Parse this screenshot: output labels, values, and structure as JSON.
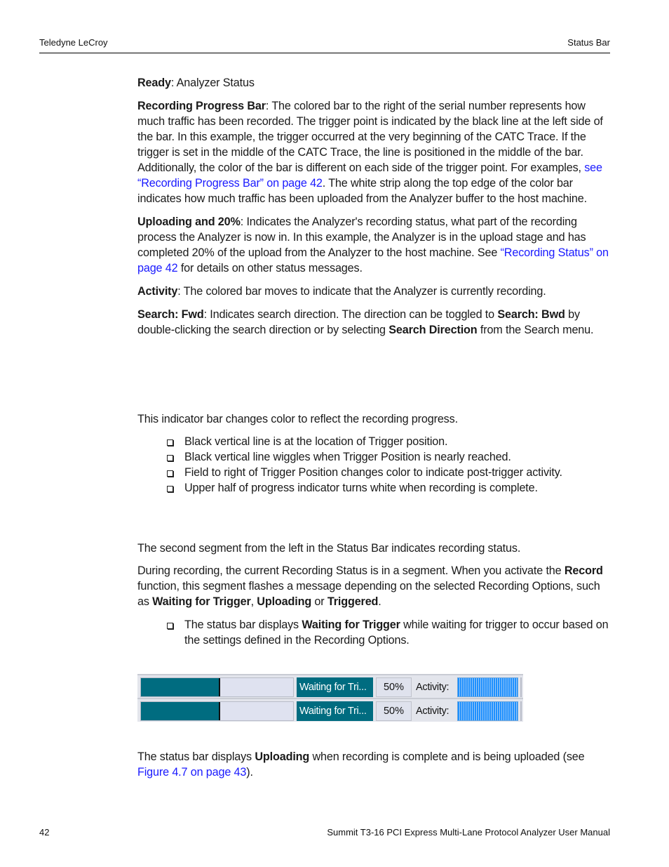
{
  "header": {
    "left": "Teledyne LeCroy",
    "right": "Status Bar"
  },
  "footer": {
    "page_number": "42",
    "manual_title": "Summit T3-16 PCI Express Multi-Lane Protocol Analyzer User Manual"
  },
  "definitions": {
    "ready": {
      "term": "Ready",
      "text": ": Analyzer Status"
    },
    "progress_bar": {
      "term": "Recording Progress Bar",
      "text1": ": The colored bar to the right of the serial number represents how much traffic has been recorded. The trigger point is indicated by the black line at the left side of the bar. In this example, the trigger occurred at the very beginning of the CATC Trace. If the trigger is set in the middle of the CATC Trace, the line is positioned in the middle of the bar. Additionally, the color of the bar is different on each side of the trigger point. For examples, ",
      "link": "see “Recording Progress Bar” on page 42",
      "text2": ". The white strip along the top edge of the color bar indicates how much traffic has been uploaded from the Analyzer buffer to the host machine."
    },
    "uploading": {
      "term": "Uploading and 20%",
      "text1": ": Indicates the Analyzer's recording status, what part of the recording process the Analyzer is now in. In this example, the Analyzer is in the upload stage and has completed 20% of the upload from the Analyzer to the host machine. See ",
      "link": "“Recording Status” on page 42",
      "text2": " for details on other status messages."
    },
    "activity": {
      "term": "Activity",
      "text": ": The colored bar moves to indicate that the Analyzer is currently recording."
    },
    "search": {
      "term": "Search: Fwd",
      "text1": ": Indicates search direction. The direction can be toggled to ",
      "bold1": "Search: Bwd",
      "text2": " by double-clicking the search direction or by selecting ",
      "bold2": "Search Direction",
      "text3": " from the Search menu."
    }
  },
  "progress_section": {
    "intro": "This indicator bar changes color to reflect the recording progress.",
    "bullets": [
      "Black vertical line is at the location of Trigger position.",
      "Black vertical line wiggles when Trigger Position is nearly reached.",
      "Field to right of Trigger Position changes color to indicate post-trigger activity.",
      "Upper half of progress indicator turns white when recording is complete."
    ]
  },
  "status_section": {
    "intro": "The second segment from the left in the Status Bar indicates recording status.",
    "p2_text1": "During recording, the current Recording Status is in a segment. When you activate the ",
    "p2_bold1": "Record",
    "p2_text2": " function, this segment flashes a message depending on the selected Recording Options, such as ",
    "p2_bold2": "Waiting for Trigger",
    "p2_text3": ", ",
    "p2_bold3": "Uploading",
    "p2_text4": " or ",
    "p2_bold4": "Triggered",
    "p2_text5": ".",
    "bullet_text1": "The status bar displays ",
    "bullet_bold": "Waiting for Trigger",
    "bullet_text2": " while waiting for trigger to occur based on the settings defined in the Recording Options."
  },
  "status_bar_figure": {
    "rows": [
      {
        "recording_progress": 0.52,
        "trigger_position": 0.52,
        "recording_status": "Waiting for Tri...",
        "percent": "50%",
        "activity_label": "Activity:"
      },
      {
        "recording_progress": 0.52,
        "trigger_position": 0.52,
        "recording_status": "Waiting for Tri...",
        "percent": "50%",
        "activity_label": "Activity:"
      }
    ],
    "colors": {
      "progress_fill": "#006c80",
      "status_bg": "#006c80",
      "activity": "#1e90ff"
    }
  },
  "uploading_section": {
    "text1": "The status bar displays ",
    "bold": "Uploading",
    "text2": " when recording is complete and is being uploaded (see ",
    "link": "Figure 4.7 on page 43",
    "text3": ")."
  }
}
